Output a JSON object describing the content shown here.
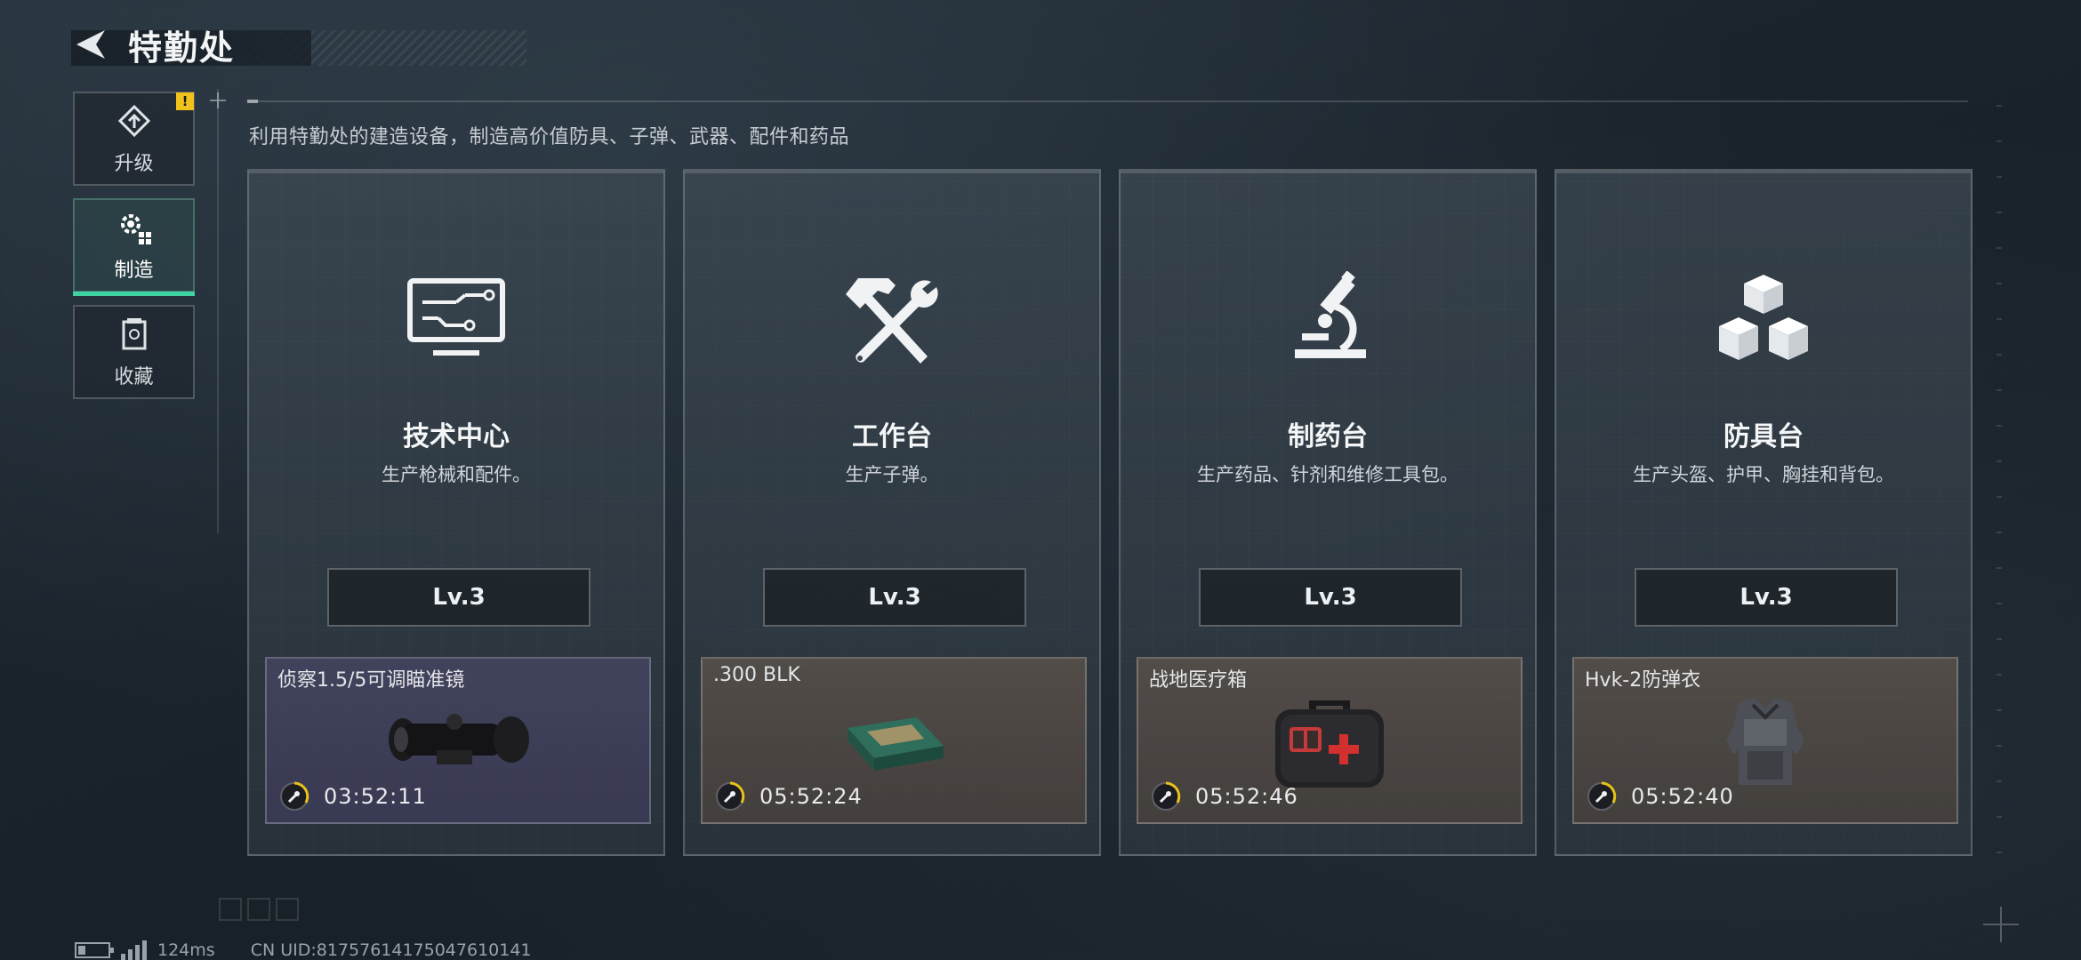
{
  "header": {
    "title": "特勤处"
  },
  "sidebar": {
    "items": [
      {
        "label": "升级",
        "badge": "!"
      },
      {
        "label": "制造"
      },
      {
        "label": "收藏"
      }
    ]
  },
  "description": "利用特勤处的建造设备，制造高价值防具、子弹、武器、配件和药品",
  "cards": [
    {
      "name": "技术中心",
      "desc": "生产枪械和配件。",
      "level": "Lv.3",
      "item": "侦察1.5/5可调瞄准镜",
      "time": "03:52:11"
    },
    {
      "name": "工作台",
      "desc": "生产子弹。",
      "level": "Lv.3",
      "item": ".300 BLK",
      "time": "05:52:24"
    },
    {
      "name": "制药台",
      "desc": "生产药品、针剂和维修工具包。",
      "level": "Lv.3",
      "item": "战地医疗箱",
      "time": "05:52:46"
    },
    {
      "name": "防具台",
      "desc": "生产头盔、护甲、胸挂和背包。",
      "level": "Lv.3",
      "item": "Hvk-2防弹衣",
      "time": "05:52:40"
    }
  ],
  "status": {
    "ping": "124ms",
    "uid": "CN UID:81757614175047610141"
  },
  "colors": {
    "accent": "#3fd3a2",
    "badge": "#f2c21c",
    "timer": "#e6c21a"
  },
  "icons": {
    "back": "back-chevron-icon",
    "upgrade": "upgrade-icon",
    "craft": "gear-icon",
    "collection": "collection-icon",
    "tech": "monitor-icon",
    "workbench": "hammer-wrench-icon",
    "pharmacy": "microscope-icon",
    "armor": "cubes-icon"
  }
}
